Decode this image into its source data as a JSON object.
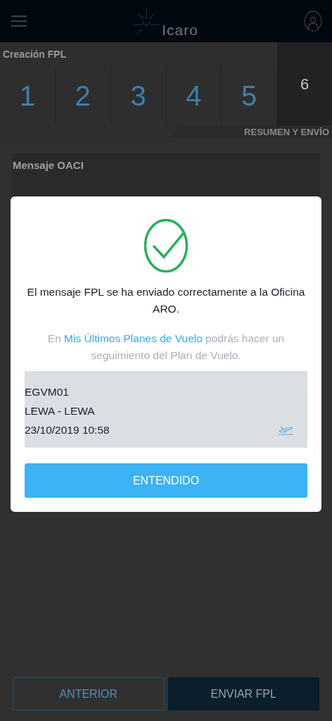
{
  "header": {
    "logo": "Icaro"
  },
  "wizard": {
    "title": "Creación FPL",
    "steps": [
      {
        "label": "1",
        "selected": false
      },
      {
        "label": "2",
        "selected": false
      },
      {
        "label": "3",
        "selected": false
      },
      {
        "label": "4",
        "selected": false
      },
      {
        "label": "5",
        "selected": false
      },
      {
        "label": "6",
        "selected": true
      }
    ],
    "step_caption": "RESUMEN Y ENVÍO"
  },
  "section": {
    "title": "Mensaje OACI"
  },
  "dialog": {
    "message": "El mensaje FPL se ha enviado correctamente a la Oficina ARO.",
    "hint_before": "En ",
    "hint_link": "Mis Últimos Planes de Vuelo",
    "hint_after": " podrás hacer un seguimiento del Plan de Vuelo.",
    "plan": {
      "lines": [
        "EGVM01",
        "LEWA - LEWA",
        "23/10/2019 10:58"
      ]
    },
    "button": "ENTENDIDO"
  },
  "footer": {
    "buttons": [
      {
        "label": "ANTERIOR",
        "kind": "outline"
      },
      {
        "label": "ENVIAR FPL",
        "kind": "filled"
      }
    ]
  }
}
